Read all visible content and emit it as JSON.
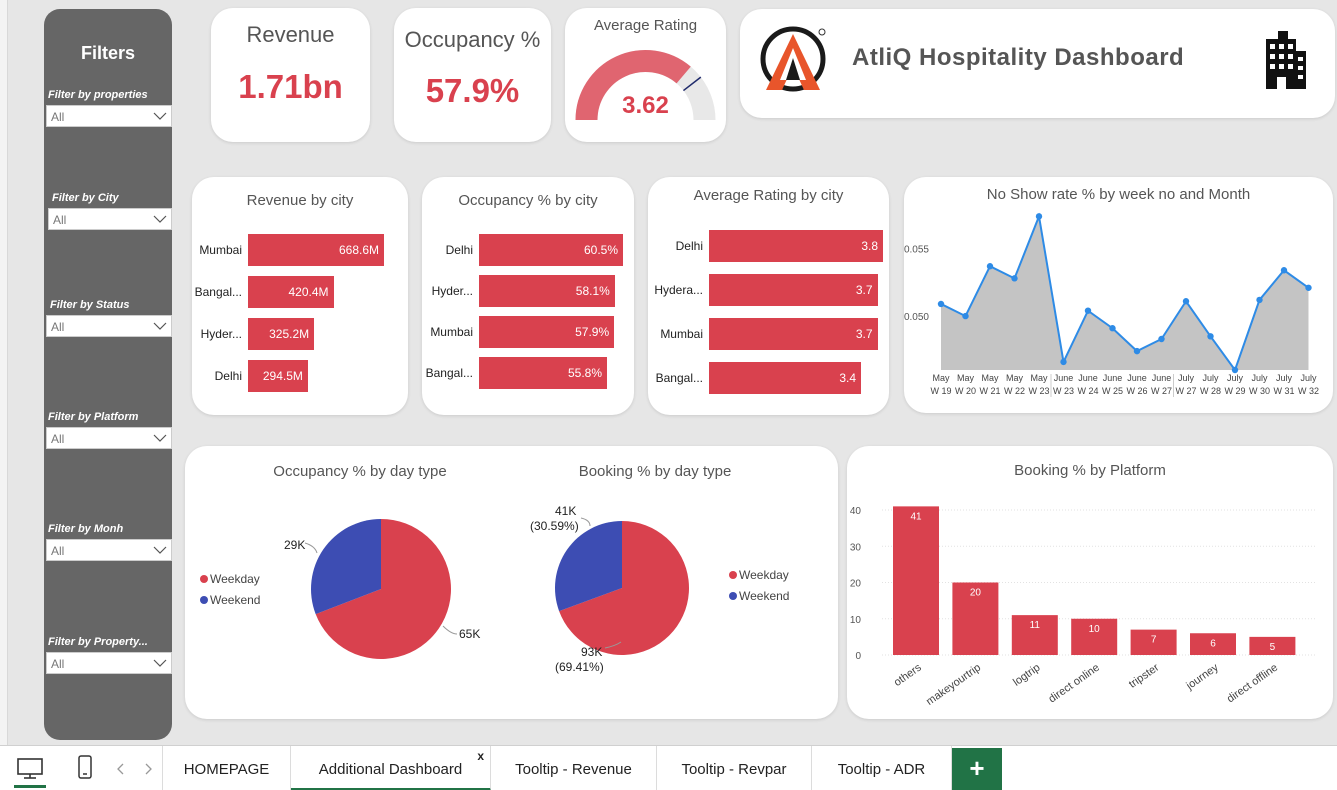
{
  "sidebar": {
    "title": "Filters",
    "filters": [
      {
        "label": "Filter by properties",
        "value": "All"
      },
      {
        "label": "Filter by City",
        "value": "All"
      },
      {
        "label": "Filter by Status",
        "value": "All"
      },
      {
        "label": "Filter by Platform",
        "value": "All"
      },
      {
        "label": "Filter by Monh",
        "value": "All"
      },
      {
        "label": "Filter by Property...",
        "value": "All"
      }
    ]
  },
  "kpis": {
    "revenue": {
      "label": "Revenue",
      "value": "1.71bn"
    },
    "occupancy": {
      "label": "Occupancy %",
      "value": "57.9%"
    },
    "rating": {
      "label": "Average Rating",
      "value": "3.62",
      "gauge_fraction": 0.724
    }
  },
  "header": {
    "title": "AtliQ Hospitality Dashboard",
    "logo_icon": "atliq-logo-icon",
    "building_icon": "building-icon"
  },
  "colors": {
    "accent": "#d9414e",
    "series_blue": "#3d4db3",
    "brand_green": "#217346"
  },
  "chart_data": [
    {
      "type": "bar",
      "orientation": "horizontal",
      "title": "Revenue by city",
      "categories": [
        "Mumbai",
        "Bangal...",
        "Hyder...",
        "Delhi"
      ],
      "values": [
        668.6,
        420.4,
        325.2,
        294.5
      ],
      "labels": [
        "668.6M",
        "420.4M",
        "325.2M",
        "294.5M"
      ]
    },
    {
      "type": "bar",
      "orientation": "horizontal",
      "title": "Occupancy % by city",
      "categories": [
        "Delhi",
        "Hyder...",
        "Mumbai",
        "Bangal..."
      ],
      "values": [
        60.5,
        58.1,
        57.9,
        55.8
      ],
      "labels": [
        "60.5%",
        "58.1%",
        "57.9%",
        "55.8%"
      ]
    },
    {
      "type": "bar",
      "orientation": "horizontal",
      "title": "Average Rating by city",
      "categories": [
        "Delhi",
        "Hydera...",
        "Mumbai",
        "Bangal..."
      ],
      "values": [
        3.8,
        3.7,
        3.7,
        3.4
      ],
      "labels": [
        "3.8",
        "3.7",
        "3.7",
        "3.4"
      ]
    },
    {
      "type": "area",
      "title": "No Show rate % by week no and Month",
      "x": [
        [
          "May",
          "W 19"
        ],
        [
          "May",
          "W 20"
        ],
        [
          "May",
          "W 21"
        ],
        [
          "May",
          "W 22"
        ],
        [
          "May",
          "W 23"
        ],
        [
          "June",
          "W 23"
        ],
        [
          "June",
          "W 24"
        ],
        [
          "June",
          "W 25"
        ],
        [
          "June",
          "W 26"
        ],
        [
          "June",
          "W 27"
        ],
        [
          "July",
          "W 27"
        ],
        [
          "July",
          "W 28"
        ],
        [
          "July",
          "W 29"
        ],
        [
          "July",
          "W 30"
        ],
        [
          "July",
          "W 31"
        ],
        [
          "July",
          "W 32"
        ]
      ],
      "y": [
        0.0509,
        0.05,
        0.0537,
        0.0528,
        0.0574,
        0.0466,
        0.0504,
        0.0491,
        0.0474,
        0.0483,
        0.0511,
        0.0485,
        0.046,
        0.0512,
        0.0534,
        0.0521
      ],
      "yticks": [
        "0.055",
        "0.050"
      ],
      "ylim": [
        0.046,
        0.0575
      ]
    },
    {
      "type": "pie",
      "title": "Occupancy % by day type",
      "slices": [
        {
          "name": "Weekday",
          "value": 65,
          "label": "65K"
        },
        {
          "name": "Weekend",
          "value": 29,
          "label": "29K"
        }
      ],
      "legend": [
        "Weekday",
        "Weekend"
      ]
    },
    {
      "type": "pie",
      "title": "Booking % by day type",
      "slices": [
        {
          "name": "Weekday",
          "value": 93,
          "label": "93K",
          "pct": "(69.41%)"
        },
        {
          "name": "Weekend",
          "value": 41,
          "label": "41K",
          "pct": "(30.59%)"
        }
      ],
      "legend": [
        "Weekday",
        "Weekend"
      ]
    },
    {
      "type": "bar",
      "title": "Booking % by Platform",
      "categories": [
        "others",
        "makeyourtrip",
        "logtrip",
        "direct online",
        "tripster",
        "journey",
        "direct offline"
      ],
      "values": [
        41,
        20,
        11,
        10,
        7,
        6,
        5
      ],
      "yticks": [
        "40",
        "30",
        "20",
        "10",
        "0"
      ],
      "ylim": [
        0,
        40
      ]
    }
  ],
  "tabs": {
    "items": [
      "HOMEPAGE",
      "Additional Dashboard",
      "Tooltip - Revenue",
      "Tooltip - Revpar",
      "Tooltip - ADR"
    ],
    "active": "Additional Dashboard",
    "close": "x",
    "add": "+"
  }
}
